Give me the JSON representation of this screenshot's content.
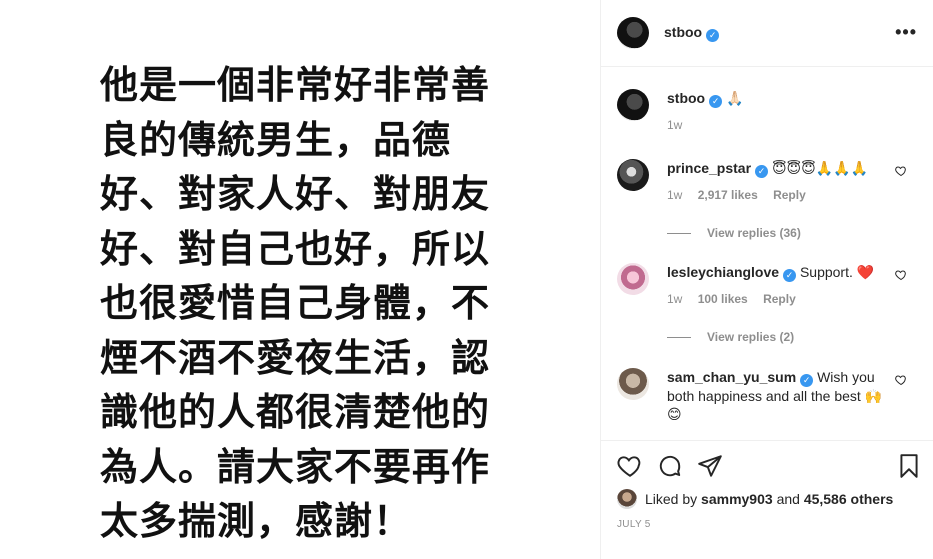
{
  "media": {
    "text": "他是一個非常好非常善\n良的傳統男生，品德\n好、對家人好、對朋友\n好、對自己也好，所以\n也很愛惜自己身體，不\n煙不酒不愛夜生活，認\n識他的人都很清楚他的\n為人。請大家不要再作\n太多揣測，感謝！"
  },
  "header": {
    "username": "stboo",
    "verified_glyph": "✓",
    "more_glyph": "•••"
  },
  "caption": {
    "username": "stboo",
    "text": "🙏🏻",
    "time": "1w"
  },
  "comments": [
    {
      "username": "prince_pstar",
      "text": "😇😇😇🙏🙏🙏",
      "time": "1w",
      "likes": "2,917 likes",
      "reply": "Reply",
      "view_replies": "View replies (36)"
    },
    {
      "username": "lesleychianglove",
      "text": "Support. ❤️",
      "time": "1w",
      "likes": "100 likes",
      "reply": "Reply",
      "view_replies": "View replies (2)"
    },
    {
      "username": "sam_chan_yu_sum",
      "text": "Wish you both happiness and all the best",
      "text_emoji": "🙌😊"
    }
  ],
  "likes": {
    "prefix": "Liked by",
    "user": "sammy903",
    "and": "and",
    "others": "45,586 others"
  },
  "date": "JULY 5",
  "icons": [
    "heart-icon",
    "comment-icon",
    "share-icon",
    "bookmark-icon",
    "more-icon"
  ]
}
